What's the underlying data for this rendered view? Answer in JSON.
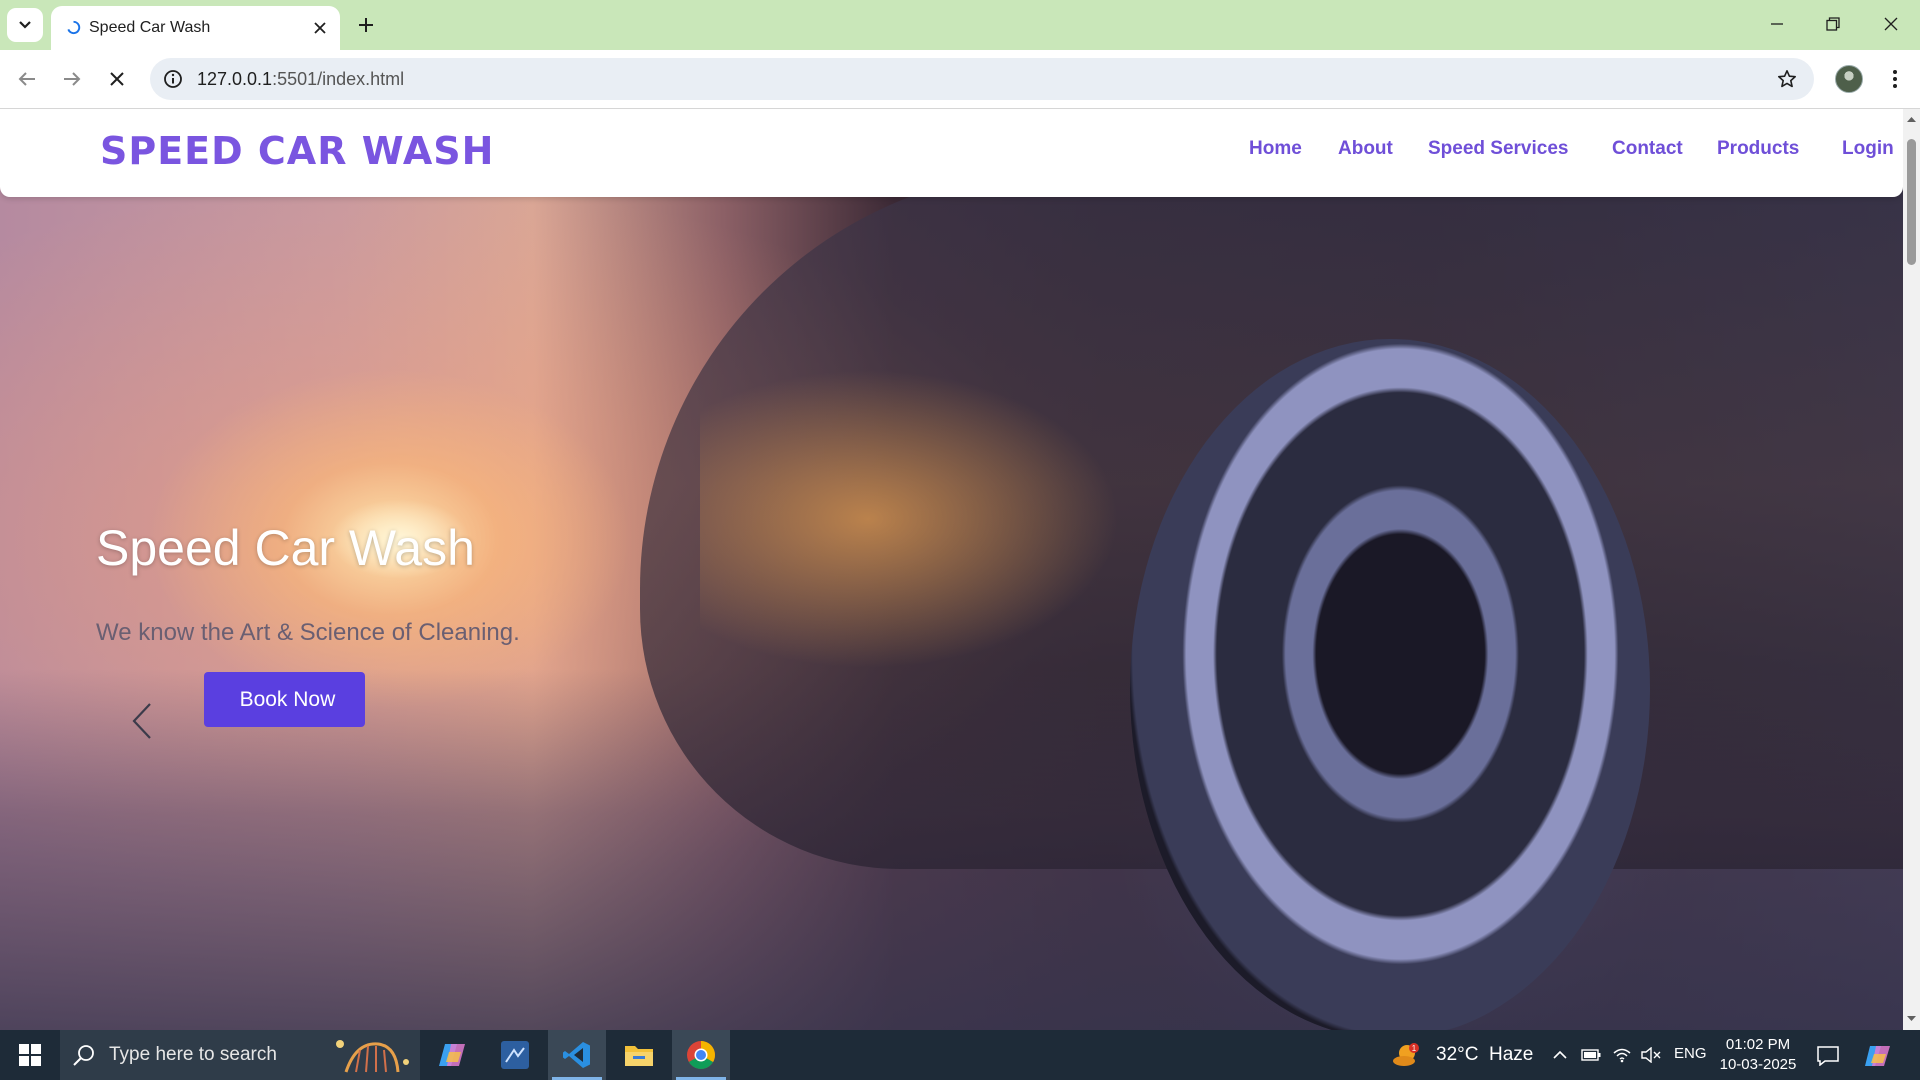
{
  "browser": {
    "tab_title": "Speed Car Wash",
    "url_host": "127.0.0.1",
    "url_rest": ":5501/index.html"
  },
  "site": {
    "logo": "SPEED CAR WASH",
    "nav": {
      "home": "Home",
      "about": "About",
      "services": "Speed Services",
      "services_caret": "",
      "contact": "Contact",
      "products": "Products",
      "login": "Login"
    },
    "hero": {
      "title": "Speed Car Wash",
      "subtitle": "We know the Art & Science of Cleaning.",
      "button_icon": "",
      "button_label": "Book Now"
    }
  },
  "taskbar": {
    "search_placeholder": "Type here to search",
    "weather_temp": "32°C",
    "weather_desc": "Haze",
    "weather_badge": "1",
    "language": "ENG",
    "time": "01:02 PM",
    "date": "10-03-2025"
  },
  "colors": {
    "brand": "#7a55e0",
    "button": "#5a3fe0",
    "tabbar": "#c9e7b9",
    "taskbar": "#1e2b38"
  },
  "icons": [
    "tab-search-icon",
    "loading-spinner-icon",
    "close-icon",
    "plus-icon",
    "minimize-icon",
    "restore-icon",
    "back-arrow-icon",
    "forward-arrow-icon",
    "stop-icon",
    "info-icon",
    "star-icon",
    "avatar",
    "kebab-menu-icon",
    "chevron-left-icon",
    "windows-logo-icon",
    "search-icon",
    "copilot-icon",
    "snipping-tool-icon",
    "vscode-icon",
    "file-explorer-icon",
    "chrome-icon",
    "weather-icon",
    "chevron-up-icon",
    "battery-icon",
    "wifi-icon",
    "speaker-muted-icon",
    "notification-icon"
  ]
}
